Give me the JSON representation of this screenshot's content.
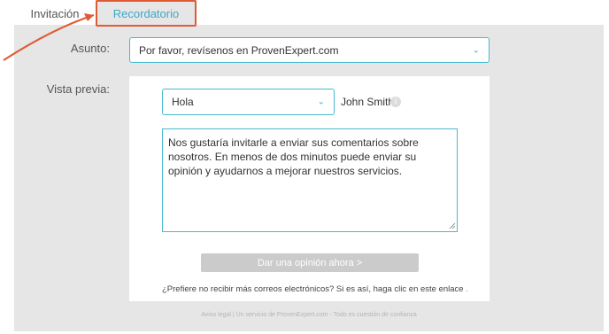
{
  "tabs": [
    {
      "label": "Invitación"
    },
    {
      "label": "Recordatorio"
    }
  ],
  "form": {
    "subject_label": "Asunto:",
    "subject_value": "Por favor, revísenos en ProvenExpert.com",
    "preview_label": "Vista previa:"
  },
  "preview": {
    "greeting_value": "Hola",
    "recipient_name": "John Smith,",
    "message": "Nos gustaría invitarle a enviar sus comentarios sobre nosotros. En menos de dos minutos puede enviar su opinión y ayudarnos a mejorar nuestros servicios.",
    "cta_label": "Dar una opinión ahora >",
    "optout_text": "¿Prefiere no recibir más correos electrónicos? Si es así, haga clic en este enlace",
    "optout_link": " ."
  },
  "footer": {
    "text": "Aviso legal | Un servicio de ProvenExpert.com - Todo es cuestión de confianza"
  },
  "icons": {
    "chevron": "chevron-down-icon",
    "info": "info-icon"
  },
  "colors": {
    "accent": "#49b9cf",
    "highlight": "#e05a34",
    "panel": "#e6e6e6",
    "button_disabled": "#cbcbcb"
  }
}
